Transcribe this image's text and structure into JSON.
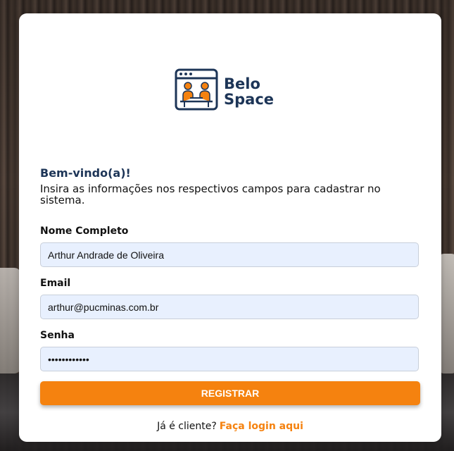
{
  "brand": {
    "logo_line1": "Belo",
    "logo_line2": "Space",
    "primary_color": "#1d3557",
    "accent_color": "#f5820f"
  },
  "header": {
    "welcome": "Bem-vindo(a)!",
    "subtitle": "Insira as informações nos respectivos campos para cadastrar no sistema."
  },
  "form": {
    "name_label": "Nome Completo",
    "name_value": "Arthur Andrade de Oliveira",
    "email_label": "Email",
    "email_value": "arthur@pucminas.com.br",
    "password_label": "Senha",
    "password_value": "••••••••••••",
    "submit_label": "REGISTRAR"
  },
  "footer": {
    "prompt": "Já é cliente?",
    "login_link": "Faça login aqui"
  }
}
